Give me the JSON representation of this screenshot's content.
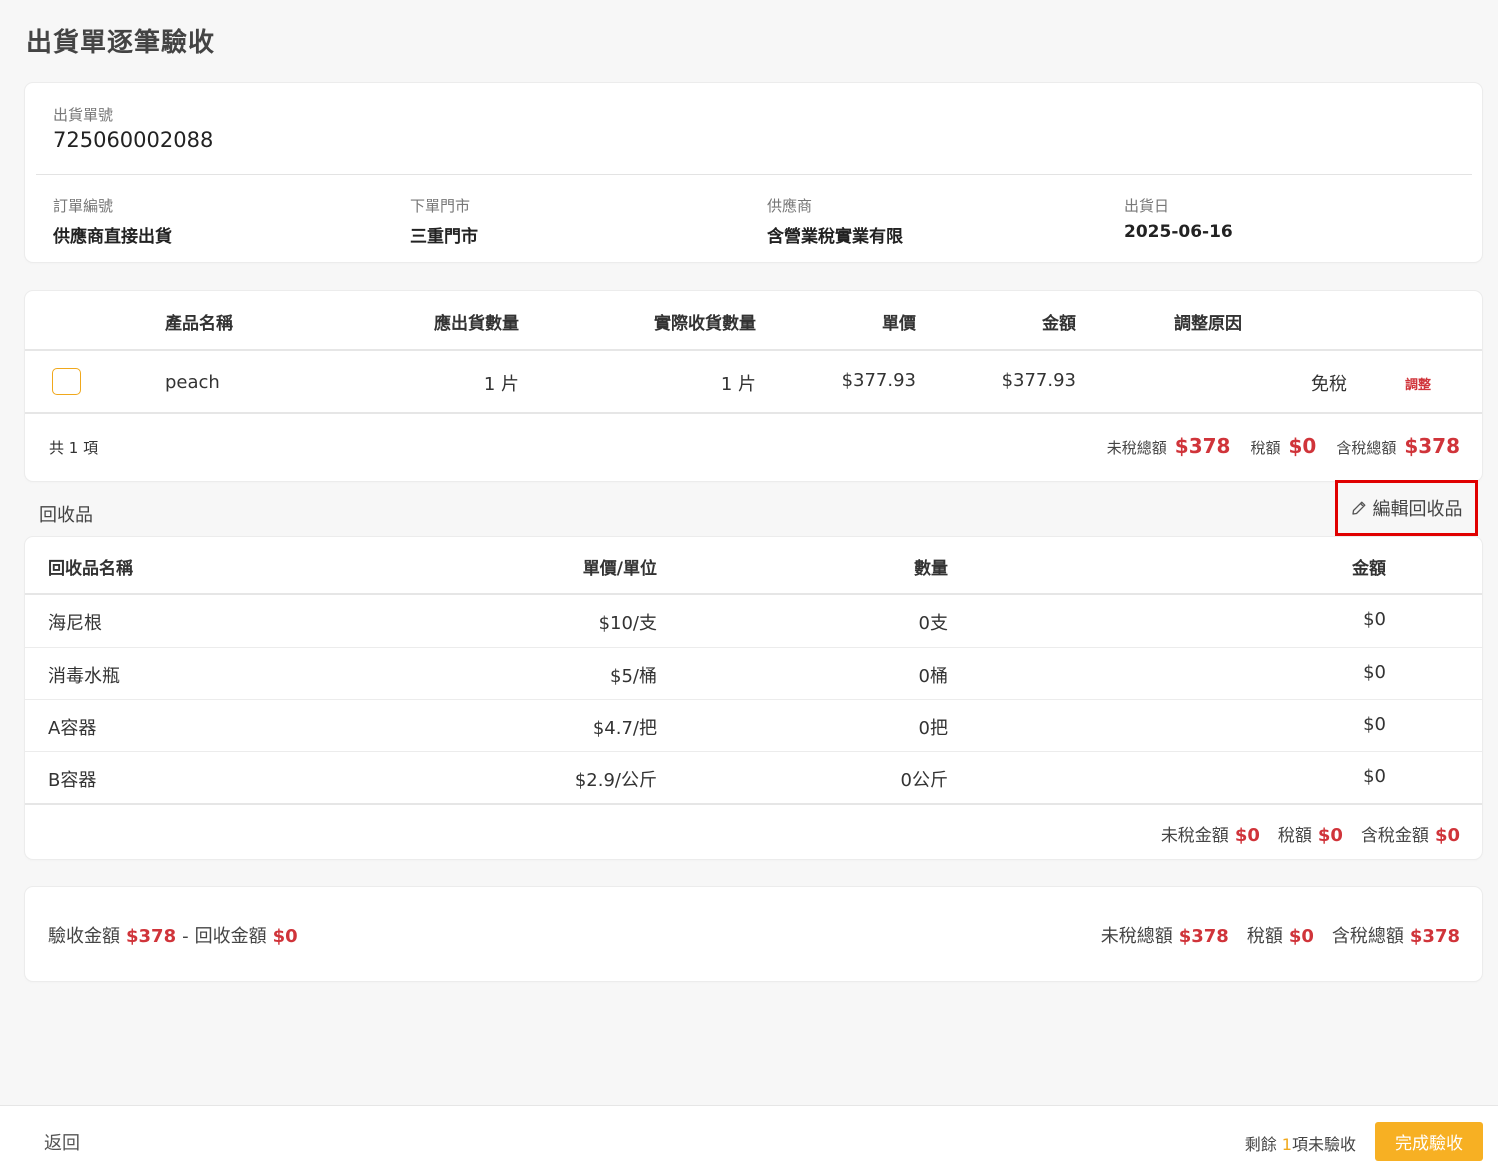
{
  "page": {
    "title": "出貨單逐筆驗收"
  },
  "info": {
    "ship_no_label": "出貨單號",
    "ship_no": "725060002088",
    "order_no_label": "訂單編號",
    "order_no": "供應商直接出貨",
    "store_label": "下單門市",
    "store": "三重門市",
    "supplier_label": "供應商",
    "supplier": "含營業稅實業有限",
    "ship_date_label": "出貨日",
    "ship_date": "2025-06-16"
  },
  "products": {
    "headers": {
      "name": "產品名稱",
      "expected_qty": "應出貨數量",
      "actual_qty": "實際收貨數量",
      "unit_price": "單價",
      "amount": "金額",
      "reason": "調整原因"
    },
    "rows": [
      {
        "name": "peach",
        "expected_qty": "1 片",
        "actual_qty": "1 片",
        "unit_price": "$377.93",
        "amount": "$377.93",
        "tax_type": "免稅",
        "adjust_label": "調整"
      }
    ],
    "count_text": "共 1 項",
    "summary": {
      "pretax_label": "未稅總額",
      "pretax": "$378",
      "tax_label": "稅額",
      "tax": "$0",
      "total_label": "含稅總額",
      "total": "$378"
    }
  },
  "recycle": {
    "title": "回收品",
    "edit_label": "編輯回收品",
    "headers": {
      "name": "回收品名稱",
      "unit_price": "單價/單位",
      "qty": "數量",
      "amount": "金額"
    },
    "rows": [
      {
        "name": "海尼根",
        "unit_price": "$10/支",
        "qty": "0支",
        "amount": "$0"
      },
      {
        "name": "消毒水瓶",
        "unit_price": "$5/桶",
        "qty": "0桶",
        "amount": "$0"
      },
      {
        "name": "A容器",
        "unit_price": "$4.7/把",
        "qty": "0把",
        "amount": "$0"
      },
      {
        "name": "B容器",
        "unit_price": "$2.9/公斤",
        "qty": "0公斤",
        "amount": "$0"
      }
    ],
    "summary": {
      "pretax_label": "未稅金額",
      "pretax": "$0",
      "tax_label": "稅額",
      "tax": "$0",
      "total_label": "含稅金額",
      "total": "$0"
    }
  },
  "totals": {
    "accept_label": "驗收金額",
    "accept": "$378",
    "minus": "-",
    "recycle_label": "回收金額",
    "recycle": "$0",
    "pretax_label": "未稅總額",
    "pretax": "$378",
    "tax_label": "稅額",
    "tax": "$0",
    "total_label": "含稅總額",
    "total": "$378"
  },
  "footer": {
    "back_label": "返回",
    "remain_prefix": "剩餘",
    "remain_count": "1",
    "remain_suffix": "項未驗收",
    "complete_label": "完成驗收"
  },
  "colors": {
    "accent": "#f7b023",
    "price_red": "#d0343a",
    "highlight_box": "#e00000"
  }
}
